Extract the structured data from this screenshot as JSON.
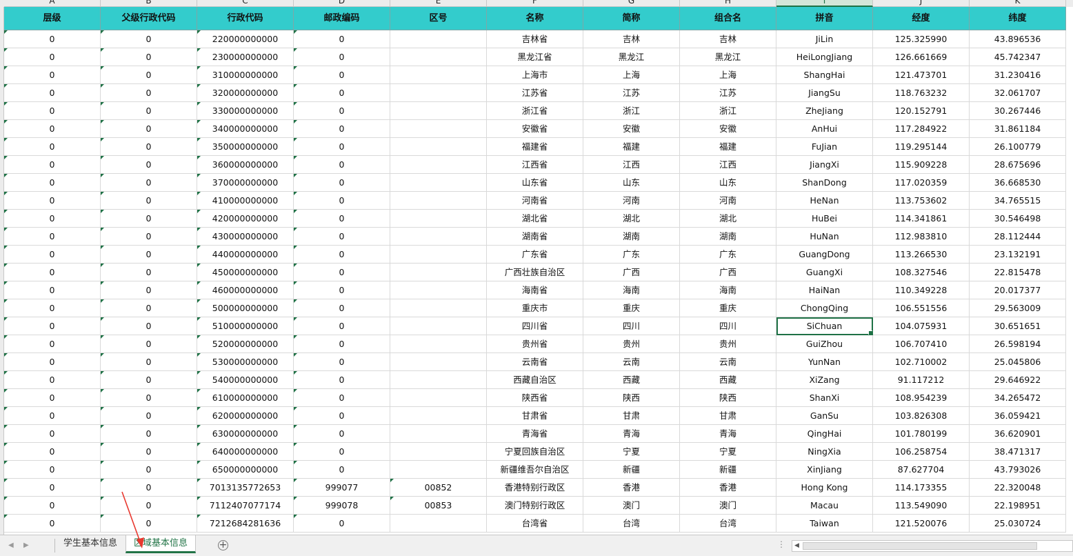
{
  "columns": [
    "A",
    "B",
    "C",
    "D",
    "E",
    "F",
    "G",
    "H",
    "I",
    "J",
    "K"
  ],
  "selected_column": "I",
  "headers": [
    "层级",
    "父级行政代码",
    "行政代码",
    "邮政编码",
    "区号",
    "名称",
    "简称",
    "组合名",
    "拼音",
    "经度",
    "纬度"
  ],
  "rows": [
    [
      "0",
      "0",
      "220000000000",
      "0",
      "",
      "吉林省",
      "吉林",
      "吉林",
      "JiLin",
      "125.325990",
      "43.896536"
    ],
    [
      "0",
      "0",
      "230000000000",
      "0",
      "",
      "黑龙江省",
      "黑龙江",
      "黑龙江",
      "HeiLongJiang",
      "126.661669",
      "45.742347"
    ],
    [
      "0",
      "0",
      "310000000000",
      "0",
      "",
      "上海市",
      "上海",
      "上海",
      "ShangHai",
      "121.473701",
      "31.230416"
    ],
    [
      "0",
      "0",
      "320000000000",
      "0",
      "",
      "江苏省",
      "江苏",
      "江苏",
      "JiangSu",
      "118.763232",
      "32.061707"
    ],
    [
      "0",
      "0",
      "330000000000",
      "0",
      "",
      "浙江省",
      "浙江",
      "浙江",
      "ZheJiang",
      "120.152791",
      "30.267446"
    ],
    [
      "0",
      "0",
      "340000000000",
      "0",
      "",
      "安徽省",
      "安徽",
      "安徽",
      "AnHui",
      "117.284922",
      "31.861184"
    ],
    [
      "0",
      "0",
      "350000000000",
      "0",
      "",
      "福建省",
      "福建",
      "福建",
      "FuJian",
      "119.295144",
      "26.100779"
    ],
    [
      "0",
      "0",
      "360000000000",
      "0",
      "",
      "江西省",
      "江西",
      "江西",
      "JiangXi",
      "115.909228",
      "28.675696"
    ],
    [
      "0",
      "0",
      "370000000000",
      "0",
      "",
      "山东省",
      "山东",
      "山东",
      "ShanDong",
      "117.020359",
      "36.668530"
    ],
    [
      "0",
      "0",
      "410000000000",
      "0",
      "",
      "河南省",
      "河南",
      "河南",
      "HeNan",
      "113.753602",
      "34.765515"
    ],
    [
      "0",
      "0",
      "420000000000",
      "0",
      "",
      "湖北省",
      "湖北",
      "湖北",
      "HuBei",
      "114.341861",
      "30.546498"
    ],
    [
      "0",
      "0",
      "430000000000",
      "0",
      "",
      "湖南省",
      "湖南",
      "湖南",
      "HuNan",
      "112.983810",
      "28.112444"
    ],
    [
      "0",
      "0",
      "440000000000",
      "0",
      "",
      "广东省",
      "广东",
      "广东",
      "GuangDong",
      "113.266530",
      "23.132191"
    ],
    [
      "0",
      "0",
      "450000000000",
      "0",
      "",
      "广西壮族自治区",
      "广西",
      "广西",
      "GuangXi",
      "108.327546",
      "22.815478"
    ],
    [
      "0",
      "0",
      "460000000000",
      "0",
      "",
      "海南省",
      "海南",
      "海南",
      "HaiNan",
      "110.349228",
      "20.017377"
    ],
    [
      "0",
      "0",
      "500000000000",
      "0",
      "",
      "重庆市",
      "重庆",
      "重庆",
      "ChongQing",
      "106.551556",
      "29.563009"
    ],
    [
      "0",
      "0",
      "510000000000",
      "0",
      "",
      "四川省",
      "四川",
      "四川",
      "SiChuan",
      "104.075931",
      "30.651651"
    ],
    [
      "0",
      "0",
      "520000000000",
      "0",
      "",
      "贵州省",
      "贵州",
      "贵州",
      "GuiZhou",
      "106.707410",
      "26.598194"
    ],
    [
      "0",
      "0",
      "530000000000",
      "0",
      "",
      "云南省",
      "云南",
      "云南",
      "YunNan",
      "102.710002",
      "25.045806"
    ],
    [
      "0",
      "0",
      "540000000000",
      "0",
      "",
      "西藏自治区",
      "西藏",
      "西藏",
      "XiZang",
      "91.117212",
      "29.646922"
    ],
    [
      "0",
      "0",
      "610000000000",
      "0",
      "",
      "陕西省",
      "陕西",
      "陕西",
      "ShanXi",
      "108.954239",
      "34.265472"
    ],
    [
      "0",
      "0",
      "620000000000",
      "0",
      "",
      "甘肃省",
      "甘肃",
      "甘肃",
      "GanSu",
      "103.826308",
      "36.059421"
    ],
    [
      "0",
      "0",
      "630000000000",
      "0",
      "",
      "青海省",
      "青海",
      "青海",
      "QingHai",
      "101.780199",
      "36.620901"
    ],
    [
      "0",
      "0",
      "640000000000",
      "0",
      "",
      "宁夏回族自治区",
      "宁夏",
      "宁夏",
      "NingXia",
      "106.258754",
      "38.471317"
    ],
    [
      "0",
      "0",
      "650000000000",
      "0",
      "",
      "新疆维吾尔自治区",
      "新疆",
      "新疆",
      "XinJiang",
      "87.627704",
      "43.793026"
    ],
    [
      "0",
      "0",
      "7013135772653",
      "999077",
      "00852",
      "香港特别行政区",
      "香港",
      "香港",
      "Hong Kong",
      "114.173355",
      "22.320048"
    ],
    [
      "0",
      "0",
      "7112407077174",
      "999078",
      "00853",
      "澳门特别行政区",
      "澳门",
      "澳门",
      "Macau",
      "113.549090",
      "22.198951"
    ],
    [
      "0",
      "0",
      "7212684281636",
      "0",
      "",
      "台湾省",
      "台湾",
      "台湾",
      "Taiwan",
      "121.520076",
      "25.030724"
    ]
  ],
  "tabs": {
    "nav_prev": "◀",
    "nav_next": "▶",
    "sheet1": "学生基本信息",
    "sheet2": "区域基本信息",
    "add": "+",
    "dots": "⋮"
  },
  "active_cell": {
    "row": 16,
    "col": 8
  },
  "colors": {
    "header_bg": "#33cccc",
    "accent": "#1e7145",
    "annotation_arrow": "#e8382f"
  }
}
